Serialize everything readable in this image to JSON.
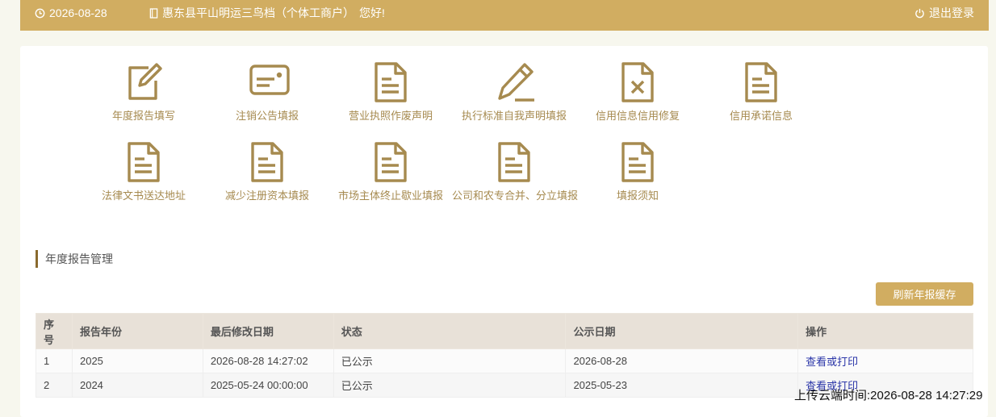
{
  "header": {
    "date": "2026-08-28",
    "company": "惠东县平山明运三鸟档（个体工商户）",
    "greeting": "您好!",
    "logout_label": "退出登录"
  },
  "tiles": [
    {
      "label": "年度报告填写",
      "icon": "edit-icon"
    },
    {
      "label": "注销公告填报",
      "icon": "id-card-icon"
    },
    {
      "label": "营业执照作废声明",
      "icon": "document-icon"
    },
    {
      "label": "执行标准自我声明填报",
      "icon": "pencil-icon"
    },
    {
      "label": "信用信息信用修复",
      "icon": "document-x-icon"
    },
    {
      "label": "信用承诺信息",
      "icon": "document-icon"
    },
    {
      "label": "法律文书送达地址",
      "icon": "document-icon"
    },
    {
      "label": "减少注册资本填报",
      "icon": "document-icon"
    },
    {
      "label": "市场主体终止歇业填报",
      "icon": "document-icon"
    },
    {
      "label": "公司和农专合并、分立填报",
      "icon": "document-icon"
    },
    {
      "label": "填报须知",
      "icon": "document-icon"
    }
  ],
  "annual": {
    "title": "年度报告管理",
    "refresh_label": "刷新年报缓存",
    "columns": [
      "序号",
      "报告年份",
      "最后修改日期",
      "状态",
      "公示日期",
      "操作"
    ],
    "rows": [
      {
        "no": "1",
        "year": "2025",
        "modified": "2026-08-28 14:27:02",
        "status": "已公示",
        "publish": "2026-08-28",
        "action": "查看或打印"
      },
      {
        "no": "2",
        "year": "2024",
        "modified": "2025-05-24 00:00:00",
        "status": "已公示",
        "publish": "2025-05-23",
        "action": "查看或打印"
      }
    ]
  },
  "upload_time": "上传云端时间:2026-08-28 14:27:29",
  "colors": {
    "accent": "#d1ad61",
    "icon": "#a68a4f",
    "link": "#2a35a8"
  }
}
